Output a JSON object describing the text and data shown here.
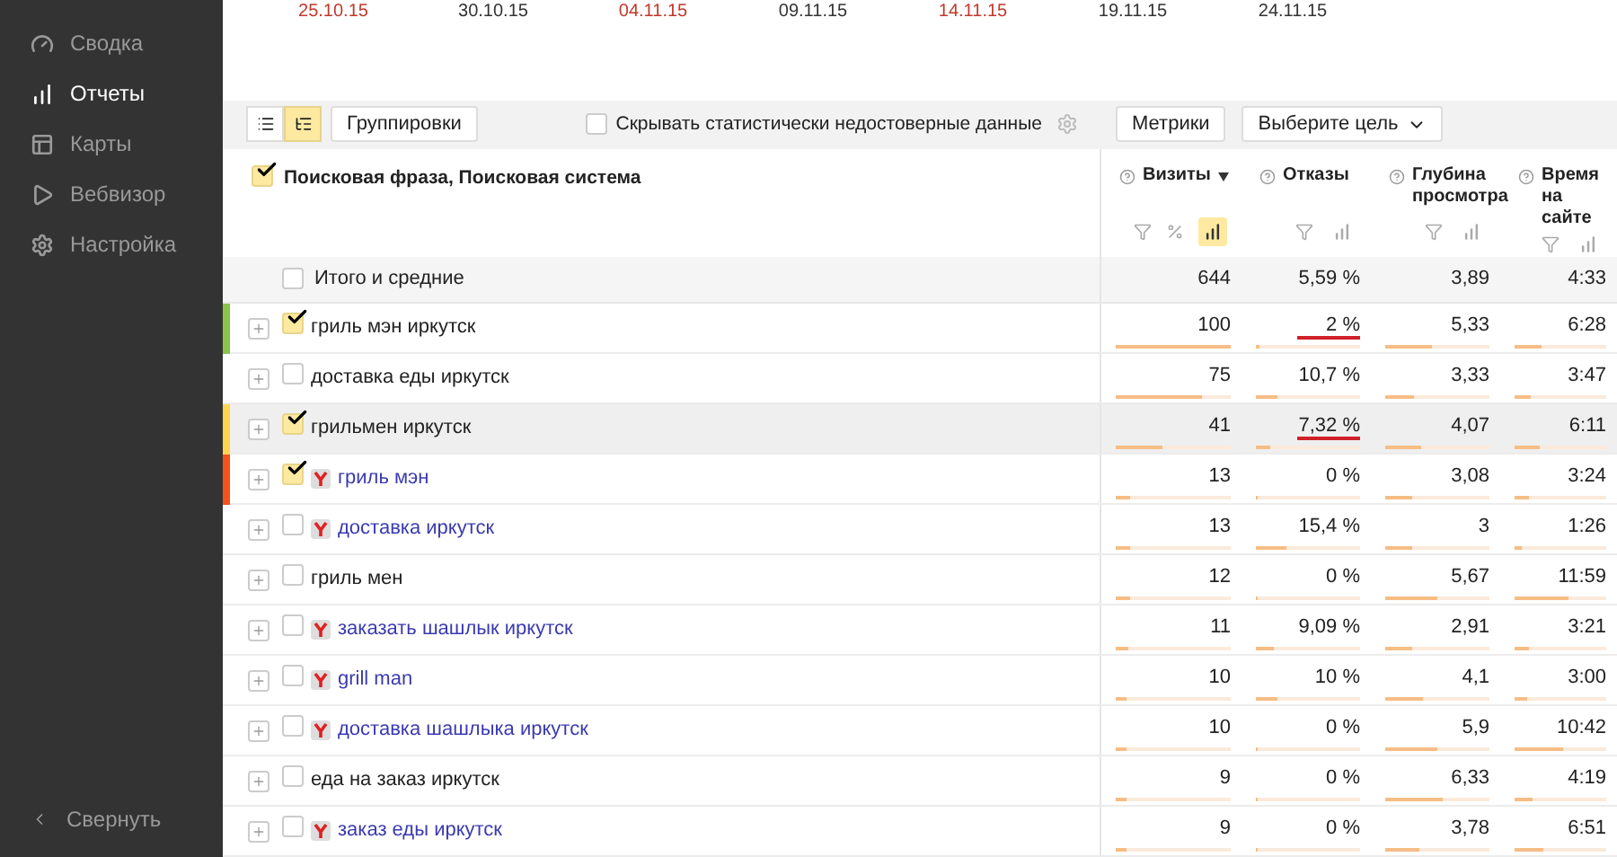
{
  "sidebar": {
    "items": [
      {
        "label": "Сводка",
        "selected": false
      },
      {
        "label": "Отчеты",
        "selected": true
      },
      {
        "label": "Карты",
        "selected": false
      },
      {
        "label": "Вебвизор",
        "selected": false
      },
      {
        "label": "Настройка",
        "selected": false
      }
    ],
    "collapse": "Свернуть"
  },
  "timeline": {
    "dates": [
      {
        "label": "25.10.15",
        "weekend": true
      },
      {
        "label": "30.10.15",
        "weekend": false
      },
      {
        "label": "04.11.15",
        "weekend": true
      },
      {
        "label": "09.11.15",
        "weekend": false
      },
      {
        "label": "14.11.15",
        "weekend": true
      },
      {
        "label": "19.11.15",
        "weekend": false
      },
      {
        "label": "24.11.15",
        "weekend": false
      }
    ]
  },
  "toolbar": {
    "view_modes": [
      {
        "kind": "list",
        "selected": false
      },
      {
        "kind": "tree",
        "selected": true
      }
    ],
    "groupings_button": "Группировки",
    "hide_unreliable": {
      "label": "Скрывать статистически недостоверные данные",
      "checked": false
    },
    "metrics_button": "Метрики",
    "goal_select": "Выберите цель"
  },
  "table": {
    "dimension": {
      "label": "Поисковая фраза, Поисковая система",
      "checked": true
    },
    "columns": [
      {
        "label": "Визиты",
        "sorted": true,
        "has_percent": true,
        "bars_selected": true
      },
      {
        "label": "Отказы",
        "sorted": false,
        "has_percent": false,
        "bars_selected": false
      },
      {
        "label": "Глубина просмотра",
        "sorted": false,
        "has_percent": false,
        "bars_selected": false
      },
      {
        "label": "Время на сайте",
        "sorted": false,
        "has_percent": false,
        "bars_selected": false
      }
    ],
    "totals": {
      "label": "Итого и средние",
      "checked": false,
      "values": [
        "644",
        "5,59 %",
        "3,89",
        "4:33"
      ]
    },
    "rows": [
      {
        "label": "гриль мэн иркутск",
        "kind": "phrase",
        "checked": true,
        "color": "#8bc34a",
        "highlighted": false,
        "bounce_alert": true,
        "cells": [
          {
            "value": "100",
            "level": 1
          },
          {
            "value": "2 %",
            "level": 0.04
          },
          {
            "value": "5,33",
            "level": 0.45
          },
          {
            "value": "6:28",
            "level": 0.3
          }
        ]
      },
      {
        "label": "доставка еды иркутск",
        "kind": "phrase",
        "checked": false,
        "highlighted": false,
        "bounce_alert": false,
        "cells": [
          {
            "value": "75",
            "level": 0.75
          },
          {
            "value": "10,7 %",
            "level": 0.2
          },
          {
            "value": "3,33",
            "level": 0.28
          },
          {
            "value": "3:47",
            "level": 0.17
          }
        ]
      },
      {
        "label": "грильмен иркутск",
        "kind": "phrase",
        "checked": true,
        "color": "#ffd54f",
        "highlighted": true,
        "bounce_alert": true,
        "cells": [
          {
            "value": "41",
            "level": 0.41
          },
          {
            "value": "7,32 %",
            "level": 0.14
          },
          {
            "value": "4,07",
            "level": 0.35
          },
          {
            "value": "6:11",
            "level": 0.28
          }
        ]
      },
      {
        "label": "гриль мэн",
        "kind": "engine",
        "checked": true,
        "color": "#f4511e",
        "highlighted": false,
        "bounce_alert": false,
        "cells": [
          {
            "value": "13",
            "level": 0.13
          },
          {
            "value": "0 %",
            "level": 0
          },
          {
            "value": "3,08",
            "level": 0.26
          },
          {
            "value": "3:24",
            "level": 0.15
          }
        ]
      },
      {
        "label": "доставка иркутск",
        "kind": "engine",
        "checked": false,
        "highlighted": false,
        "bounce_alert": false,
        "cells": [
          {
            "value": "13",
            "level": 0.13
          },
          {
            "value": "15,4 %",
            "level": 0.3
          },
          {
            "value": "3",
            "level": 0.25
          },
          {
            "value": "1:26",
            "level": 0.07
          }
        ]
      },
      {
        "label": "гриль мен",
        "kind": "phrase",
        "checked": false,
        "highlighted": false,
        "bounce_alert": false,
        "cells": [
          {
            "value": "12",
            "level": 0.12
          },
          {
            "value": "0 %",
            "level": 0
          },
          {
            "value": "5,67",
            "level": 0.5
          },
          {
            "value": "11:59",
            "level": 0.58
          }
        ]
      },
      {
        "label": "заказать шашлык иркутск",
        "kind": "engine",
        "checked": false,
        "highlighted": false,
        "bounce_alert": false,
        "cells": [
          {
            "value": "11",
            "level": 0.11
          },
          {
            "value": "9,09 %",
            "level": 0.18
          },
          {
            "value": "2,91",
            "level": 0.25
          },
          {
            "value": "3:21",
            "level": 0.15
          }
        ]
      },
      {
        "label": "grill man",
        "kind": "engine",
        "checked": false,
        "highlighted": false,
        "bounce_alert": false,
        "cells": [
          {
            "value": "10",
            "level": 0.1
          },
          {
            "value": "10 %",
            "level": 0.2
          },
          {
            "value": "4,1",
            "level": 0.37
          },
          {
            "value": "3:00",
            "level": 0.14
          }
        ]
      },
      {
        "label": "доставка шашлыка иркутск",
        "kind": "engine",
        "checked": false,
        "highlighted": false,
        "bounce_alert": false,
        "cells": [
          {
            "value": "10",
            "level": 0.1
          },
          {
            "value": "0 %",
            "level": 0
          },
          {
            "value": "5,9",
            "level": 0.5
          },
          {
            "value": "10:42",
            "level": 0.52
          }
        ]
      },
      {
        "label": "еда на заказ иркутск",
        "kind": "phrase",
        "checked": false,
        "highlighted": false,
        "bounce_alert": false,
        "cells": [
          {
            "value": "9",
            "level": 0.09
          },
          {
            "value": "0 %",
            "level": 0
          },
          {
            "value": "6,33",
            "level": 0.55
          },
          {
            "value": "4:19",
            "level": 0.2
          }
        ]
      },
      {
        "label": "заказ еды иркутск",
        "kind": "engine",
        "checked": false,
        "highlighted": false,
        "bounce_alert": false,
        "cells": [
          {
            "value": "9",
            "level": 0.09
          },
          {
            "value": "0 %",
            "level": 0
          },
          {
            "value": "3,78",
            "level": 0.32
          },
          {
            "value": "6:51",
            "level": 0.32
          }
        ]
      }
    ]
  }
}
